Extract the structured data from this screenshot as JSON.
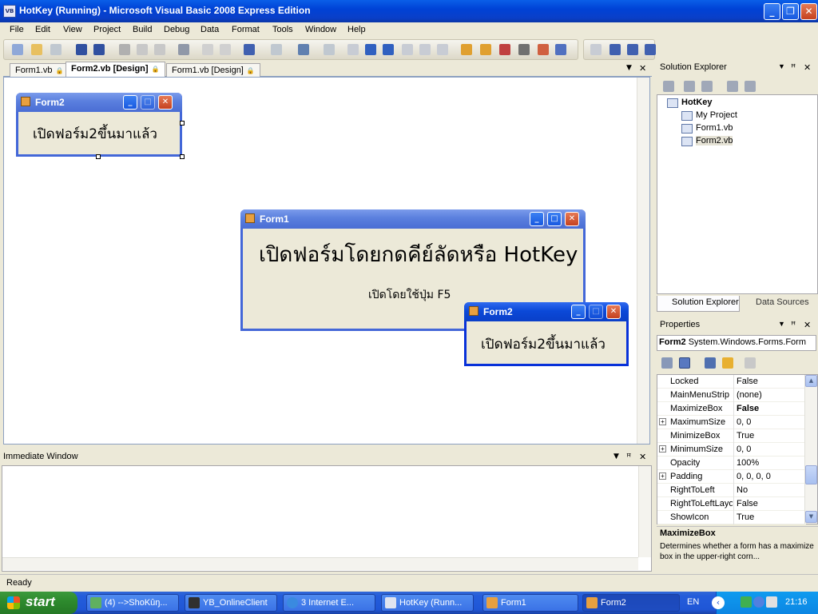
{
  "window": {
    "title": "HotKey (Running) - Microsoft Visual Basic 2008 Express Edition",
    "icon_text": "VB",
    "minimize": "_",
    "restore": "❐",
    "close": "✕"
  },
  "menu": [
    "File",
    "Edit",
    "View",
    "Project",
    "Build",
    "Debug",
    "Data",
    "Format",
    "Tools",
    "Window",
    "Help"
  ],
  "tabs": [
    {
      "label": "Form1.vb"
    },
    {
      "label": "Form2.vb [Design]"
    },
    {
      "label": "Form1.vb [Design]"
    }
  ],
  "tabs_controls": {
    "dropdown": "▼",
    "close": "✕"
  },
  "designer": {
    "form2": {
      "title": "Form2",
      "label": "เปิดฟอร์ม2ขึ้นมาแล้ว"
    }
  },
  "runtime": {
    "form1": {
      "title": "Form1",
      "heading": "เปิดฟอร์มโดยกดคีย์ลัดหรือ HotKey",
      "hint": "เปิดโดยใช้ปุ่ม F5"
    },
    "form2": {
      "title": "Form2",
      "label": "เปิดฟอร์ม2ขึ้นมาแล้ว"
    }
  },
  "solution_explorer": {
    "title": "Solution Explorer",
    "project": "HotKey",
    "items": [
      "My Project",
      "Form1.vb",
      "Form2.vb"
    ],
    "tabs": [
      "Solution Explorer",
      "Data Sources"
    ]
  },
  "panel_buttons": {
    "dropdown": "▼",
    "pin": "ꟸ",
    "close": "✕"
  },
  "properties": {
    "title": "Properties",
    "object": "Form2",
    "object_type": "System.Windows.Forms.Form",
    "rows": [
      {
        "name": "Locked",
        "value": "False",
        "expand": ""
      },
      {
        "name": "MainMenuStrip",
        "value": "(none)",
        "expand": ""
      },
      {
        "name": "MaximizeBox",
        "value": "False",
        "expand": "",
        "bold": true
      },
      {
        "name": "MaximumSize",
        "value": "0, 0",
        "expand": "+"
      },
      {
        "name": "MinimizeBox",
        "value": "True",
        "expand": ""
      },
      {
        "name": "MinimumSize",
        "value": "0, 0",
        "expand": "+"
      },
      {
        "name": "Opacity",
        "value": "100%",
        "expand": ""
      },
      {
        "name": "Padding",
        "value": "0, 0, 0, 0",
        "expand": "+"
      },
      {
        "name": "RightToLeft",
        "value": "No",
        "expand": ""
      },
      {
        "name": "RightToLeftLayo",
        "value": "False",
        "expand": ""
      },
      {
        "name": "ShowIcon",
        "value": "True",
        "expand": ""
      }
    ],
    "desc_title": "MaximizeBox",
    "desc_text": "Determines whether a form has a maximize box in the upper-right corn..."
  },
  "immediate": {
    "title": "Immediate Window"
  },
  "status": {
    "text": "Ready"
  },
  "taskbar": {
    "start": "start",
    "tasks": [
      "(4) -->ShoKûŋ...",
      "YB_OnlineClient",
      "3 Internet E...",
      "HotKey (Runn...",
      "Form1",
      "Form2"
    ],
    "lang": "EN",
    "time": "21:16"
  }
}
